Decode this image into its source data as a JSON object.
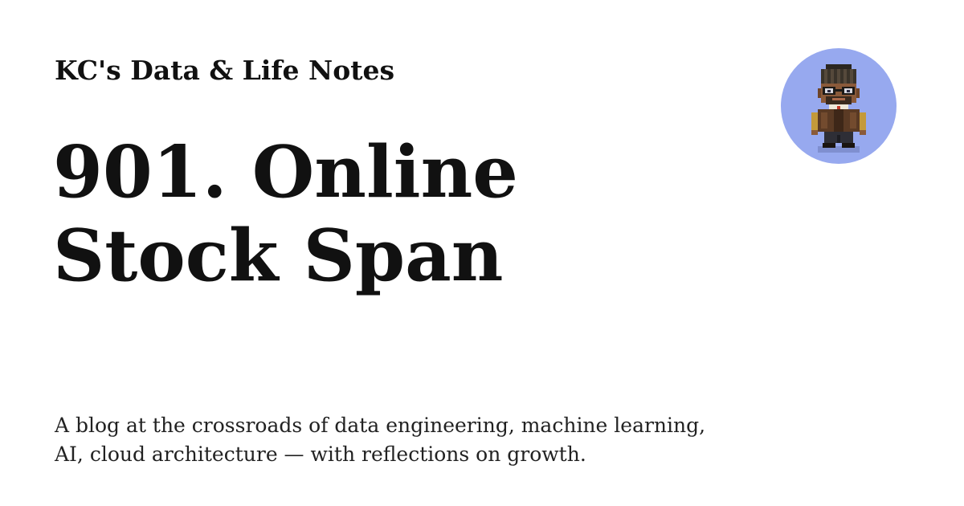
{
  "site": {
    "name": "KC's Data & Life Notes"
  },
  "post": {
    "title": "901. Online Stock Span"
  },
  "tagline": "A blog at the crossroads of data engineering, machine learning, AI, cloud architecture — with reflections on growth.",
  "avatar": {
    "icon": "pixel-art-avatar-icon",
    "background_color": "#97a9ef"
  }
}
